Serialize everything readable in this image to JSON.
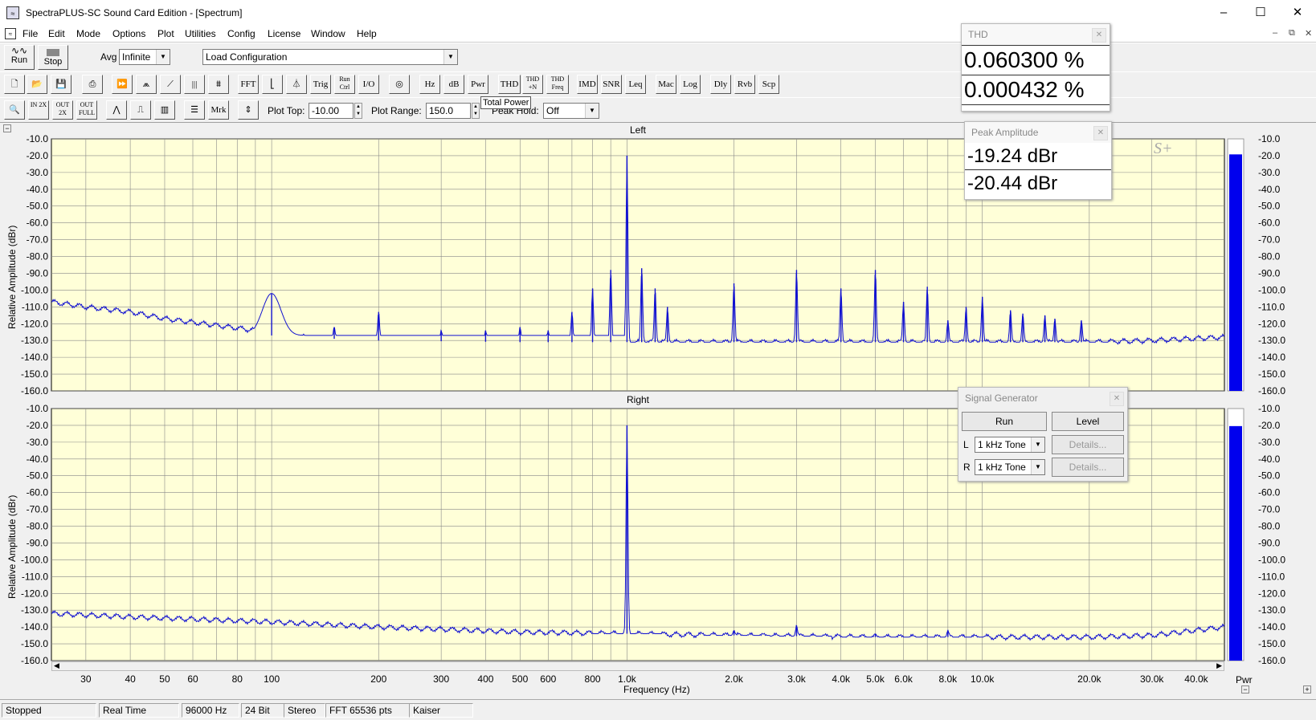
{
  "window": {
    "title": "SpectraPLUS-SC Sound Card Edition - [Spectrum]",
    "minimize": "–",
    "maximize": "☐",
    "close": "✕"
  },
  "menu": [
    "File",
    "Edit",
    "Mode",
    "Options",
    "Plot",
    "Utilities",
    "Config",
    "License",
    "Window",
    "Help"
  ],
  "toolbar1": {
    "run_label": "Run",
    "stop_label": "Stop",
    "avg_label": "Avg",
    "avg_value": "Infinite",
    "config_value": "Load Configuration"
  },
  "toolbar2": {
    "buttons": [
      "FFT",
      "Trig",
      "Run Ctrl",
      "I/O",
      "Hz",
      "dB",
      "Pwr",
      "THD",
      "THD +N",
      "THD Freq",
      "IMD",
      "SNR",
      "Leq",
      "Mac",
      "Log",
      "Dly",
      "Rvb",
      "Scp"
    ]
  },
  "toolbar3": {
    "zoom_buttons": [
      "IN 2X",
      "OUT 2X",
      "OUT FULL"
    ],
    "mrk_label": "Mrk",
    "plot_top_label": "Plot Top:",
    "plot_top_value": "-10.00",
    "plot_range_label": "Plot Range:",
    "plot_range_value": "150.0",
    "tooltip": "Total Power",
    "peak_hold_label": "Peak Hold:",
    "peak_hold_value": "Off"
  },
  "thd_panel": {
    "title": "THD",
    "values": [
      "0.060300 %",
      "0.000432 %"
    ]
  },
  "peak_panel": {
    "title": "Peak Amplitude",
    "values": [
      "-19.24 dBr",
      "-20.44 dBr"
    ]
  },
  "siggen_panel": {
    "title": "Signal Generator",
    "run_label": "Run",
    "level_label": "Level",
    "left_label": "L",
    "right_label": "R",
    "left_tone": "1 kHz Tone",
    "right_tone": "1 kHz Tone",
    "details_label": "Details..."
  },
  "meter": {
    "label": "Pwr",
    "left_level_dbr": -19.24,
    "right_level_dbr": -20.44
  },
  "watermark": "S+",
  "chart_data": [
    {
      "type": "line",
      "title": "Left",
      "ylabel": "Relative Amplitude (dBr)",
      "xlabel": "",
      "x_scale": "log",
      "xlim": [
        24,
        48000
      ],
      "ylim": [
        -160,
        -10
      ],
      "yticks": [
        "-10.0",
        "-20.0",
        "-30.0",
        "-40.0",
        "-50.0",
        "-60.0",
        "-70.0",
        "-80.0",
        "-90.0",
        "-100.0",
        "-110.0",
        "-120.0",
        "-130.0",
        "-140.0",
        "-150.0",
        "-160.0"
      ],
      "grid": true,
      "background": "#ffffd8",
      "line_color": "#1010d0",
      "noise_floor": [
        [
          24,
          -107
        ],
        [
          30,
          -110
        ],
        [
          40,
          -113
        ],
        [
          50,
          -117
        ],
        [
          70,
          -121
        ],
        [
          90,
          -124
        ],
        [
          100,
          -127
        ],
        [
          150,
          -129
        ],
        [
          200,
          -130
        ],
        [
          500,
          -131
        ],
        [
          900,
          -131
        ],
        [
          1000,
          -131
        ],
        [
          2000,
          -131
        ],
        [
          5000,
          -131
        ],
        [
          10000,
          -131
        ],
        [
          20000,
          -131
        ],
        [
          30000,
          -130
        ],
        [
          48000,
          -128
        ]
      ],
      "peaks": [
        [
          100,
          -102
        ],
        [
          150,
          -122
        ],
        [
          200,
          -113
        ],
        [
          300,
          -124
        ],
        [
          400,
          -124
        ],
        [
          500,
          -122
        ],
        [
          600,
          -124
        ],
        [
          700,
          -113
        ],
        [
          800,
          -99
        ],
        [
          900,
          -88
        ],
        [
          1000,
          -20
        ],
        [
          1100,
          -87
        ],
        [
          1200,
          -99
        ],
        [
          1300,
          -110
        ],
        [
          2000,
          -96
        ],
        [
          3000,
          -88
        ],
        [
          4000,
          -99
        ],
        [
          5000,
          -88
        ],
        [
          6000,
          -107
        ],
        [
          7000,
          -98
        ],
        [
          8000,
          -118
        ],
        [
          9000,
          -110
        ],
        [
          10000,
          -104
        ],
        [
          12000,
          -112
        ],
        [
          13000,
          -114
        ],
        [
          15000,
          -115
        ],
        [
          16000,
          -117
        ],
        [
          19000,
          -118
        ]
      ]
    },
    {
      "type": "line",
      "title": "Right",
      "ylabel": "Relative Amplitude (dBr)",
      "xlabel": "Frequency (Hz)",
      "x_scale": "log",
      "xlim": [
        24,
        48000
      ],
      "ylim": [
        -160,
        -10
      ],
      "xticks": [
        "30",
        "40",
        "50",
        "60",
        "80",
        "100",
        "200",
        "300",
        "400",
        "500",
        "600",
        "800",
        "1.0k",
        "2.0k",
        "3.0k",
        "4.0k",
        "5.0k",
        "6.0k",
        "8.0k",
        "10.0k",
        "20.0k",
        "30.0k",
        "40.0k"
      ],
      "xtick_values": [
        30,
        40,
        50,
        60,
        80,
        100,
        200,
        300,
        400,
        500,
        600,
        800,
        1000,
        2000,
        3000,
        4000,
        5000,
        6000,
        8000,
        10000,
        20000,
        30000,
        40000
      ],
      "yticks": [
        "-10.0",
        "-20.0",
        "-30.0",
        "-40.0",
        "-50.0",
        "-60.0",
        "-70.0",
        "-80.0",
        "-90.0",
        "-100.0",
        "-110.0",
        "-120.0",
        "-130.0",
        "-140.0",
        "-150.0",
        "-160.0"
      ],
      "grid": true,
      "background": "#ffffd8",
      "line_color": "#1010d0",
      "noise_floor": [
        [
          24,
          -132
        ],
        [
          40,
          -134
        ],
        [
          100,
          -137
        ],
        [
          200,
          -140
        ],
        [
          500,
          -143
        ],
        [
          1000,
          -144
        ],
        [
          2000,
          -145
        ],
        [
          5000,
          -146
        ],
        [
          10000,
          -146
        ],
        [
          20000,
          -146
        ],
        [
          30000,
          -145
        ],
        [
          48000,
          -140
        ]
      ],
      "peaks": [
        [
          1000,
          -20
        ],
        [
          2000,
          -142
        ],
        [
          3000,
          -139
        ],
        [
          5000,
          -144
        ],
        [
          8000,
          -142
        ]
      ]
    }
  ],
  "status": [
    "Stopped",
    "Real Time",
    "96000 Hz",
    "24 Bit",
    "Stereo",
    "FFT 65536 pts",
    "Kaiser"
  ]
}
